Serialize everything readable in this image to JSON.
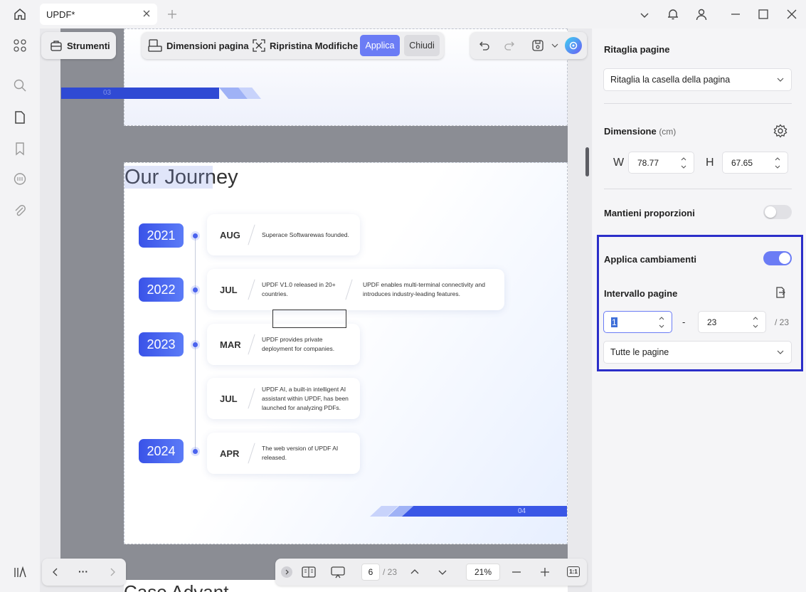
{
  "tab": {
    "title": "UPDF*"
  },
  "toolbar": {
    "tools_label": "Strumenti",
    "page_size_label": "Dimensioni pagina",
    "reset_label": "Ripristina Modifiche",
    "apply_label": "Applica",
    "close_label": "Chiudi"
  },
  "page1": {
    "page_number": "03"
  },
  "page2": {
    "heading": "Our Journey",
    "page_number": "04",
    "timeline": [
      {
        "year": "2021",
        "month": "AUG",
        "text": "Superace Softwarewas founded.",
        "text2": ""
      },
      {
        "year": "2022",
        "month": "JUL",
        "text": "UPDF V1.0 released in 20+ countries.",
        "text2": "UPDF enables multi-terminal connectivity and introduces industry-leading features."
      },
      {
        "year": "2023",
        "month": "MAR",
        "text": "UPDF provides private deployment for companies.",
        "text2": ""
      },
      {
        "year": "",
        "month": "JUL",
        "text": "UPDF AI, a built-in intelligent AI assistant within UPDF, has been launched for analyzing PDFs.",
        "text2": ""
      },
      {
        "year": "2024",
        "month": "APR",
        "text": "The web version of UPDF AI released.",
        "text2": ""
      }
    ]
  },
  "page3": {
    "heading_partial": "Case Advant"
  },
  "panel": {
    "crop_title": "Ritaglia pagine",
    "crop_mode": "Ritaglia la casella della pagina",
    "dimension_label": "Dimensione",
    "dimension_unit": "(cm)",
    "w_label": "W",
    "w_value": "78.77",
    "h_label": "H",
    "h_value": "67.65",
    "keep_ratio_label": "Mantieni proporzioni",
    "keep_ratio_on": false,
    "apply_changes_label": "Applica cambiamenti",
    "apply_changes_on": true,
    "range_label": "Intervallo pagine",
    "range_from": "1",
    "range_dash": "-",
    "range_to": "23",
    "range_total": "/ 23",
    "pages_option": "Tutte le pagine"
  },
  "bottom": {
    "more_label": "···",
    "current_page": "6",
    "total_pages": "/ 23",
    "zoom": "21%",
    "fit_label": "1:1"
  },
  "colors": {
    "accent": "#6b7cf5",
    "highlight_border": "#2b2ec9",
    "timeline_blue": "#3a53e8"
  }
}
